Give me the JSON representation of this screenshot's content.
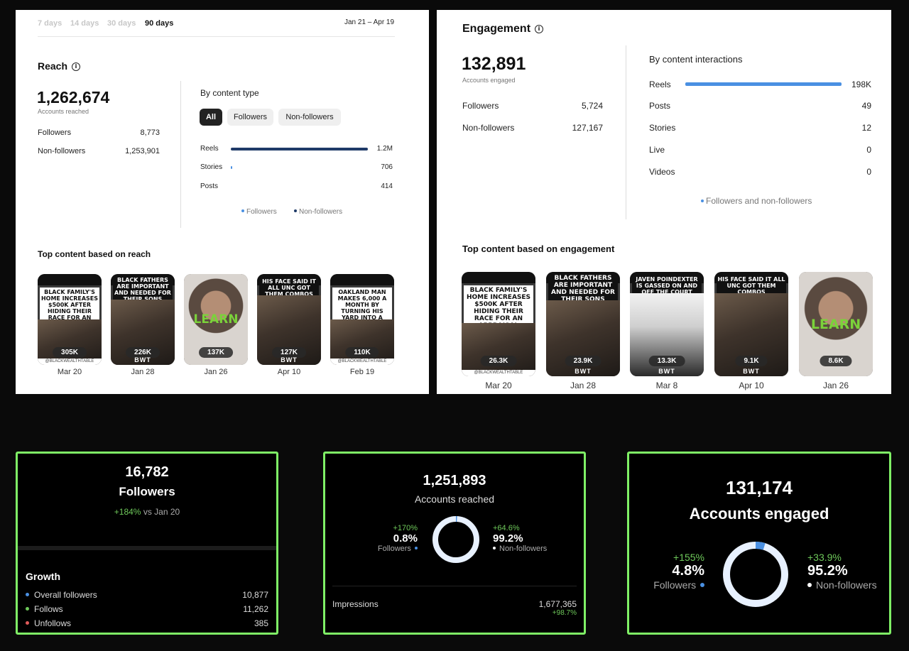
{
  "reach": {
    "ranges": [
      "7 days",
      "14 days",
      "30 days",
      "90 days"
    ],
    "active_range": "90 days",
    "date_range": "Jan 21 – Apr 19",
    "title": "Reach",
    "total": "1,262,674",
    "total_label": "Accounts reached",
    "followers_label": "Followers",
    "followers_value": "8,773",
    "nonfollowers_label": "Non-followers",
    "nonfollowers_value": "1,253,901",
    "by_type_title": "By content type",
    "pills": [
      "All",
      "Followers",
      "Non-followers"
    ],
    "bars": [
      {
        "label": "Reels",
        "value": "1.2M",
        "fraction": 1.0
      },
      {
        "label": "Stories",
        "value": "706",
        "fraction": 0.006
      },
      {
        "label": "Posts",
        "value": "414",
        "fraction": 0.0
      }
    ],
    "legend_followers": "Followers",
    "legend_nonfollowers": "Non-followers",
    "top_title": "Top content based on reach",
    "items": [
      {
        "headline": "Black family's home increases $500K after hiding their race for an appraisal",
        "count": "305K",
        "date": "Mar 20",
        "ribbon": "@BLACKWEALTHTABLE"
      },
      {
        "headline": "Black fathers are important and needed for their sons",
        "count": "226K",
        "date": "Jan 28",
        "logo": "BWT"
      },
      {
        "overlay": "LEARN",
        "count": "137K",
        "date": "Jan 26"
      },
      {
        "headline": "His face said it all unc got them combos",
        "count": "127K",
        "date": "Apr 10",
        "logo": "BWT"
      },
      {
        "headline": "Oakland man makes 6,000 a month by turning his yard into a hotel",
        "count": "110K",
        "date": "Feb 19",
        "ribbon": "@BLACKWEALTHTABLE"
      }
    ]
  },
  "engagement": {
    "title": "Engagement",
    "total": "132,891",
    "total_label": "Accounts engaged",
    "followers_label": "Followers",
    "followers_value": "5,724",
    "nonfollowers_label": "Non-followers",
    "nonfollowers_value": "127,167",
    "by_title": "By content interactions",
    "bars": [
      {
        "label": "Reels",
        "value": "198K",
        "fraction": 1.0
      },
      {
        "label": "Posts",
        "value": "49",
        "fraction": 0.0
      },
      {
        "label": "Stories",
        "value": "12",
        "fraction": 0.0
      },
      {
        "label": "Live",
        "value": "0",
        "fraction": 0.0
      },
      {
        "label": "Videos",
        "value": "0",
        "fraction": 0.0
      }
    ],
    "legend": "Followers and non-followers",
    "top_title": "Top content based on engagement",
    "items": [
      {
        "headline": "Black family's home increases $500K after hiding their race for an appraisal",
        "count": "26.3K",
        "date": "Mar 20",
        "ribbon": "@BLACKWEALTHTABLE"
      },
      {
        "headline": "Black fathers are important and needed for their sons",
        "count": "23.9K",
        "date": "Jan 28",
        "logo": "BWT"
      },
      {
        "headline": "Javen Poindexter is gassed on and off the court",
        "count": "13.3K",
        "date": "Mar 8",
        "logo": "BWT"
      },
      {
        "headline": "His face said it all unc got them combos",
        "count": "9.1K",
        "date": "Apr 10",
        "logo": "BWT"
      },
      {
        "overlay": "LEARN",
        "count": "8.6K",
        "date": "Jan 26"
      }
    ]
  },
  "followers_card": {
    "value": "16,782",
    "label": "Followers",
    "change": "+184%",
    "change_suffix": "vs Jan 20",
    "growth_title": "Growth",
    "rows": [
      {
        "label": "Overall followers",
        "value": "10,877",
        "dot_color": "#4a90e2"
      },
      {
        "label": "Follows",
        "value": "11,262",
        "dot_color": "#6ec85a"
      },
      {
        "label": "Unfollows",
        "value": "385",
        "dot_color": "#e05a5a"
      }
    ]
  },
  "reached_card": {
    "value": "1,251,893",
    "label": "Accounts reached",
    "left_change": "+170%",
    "left_pct": "0.8%",
    "left_label": "Followers",
    "right_change": "+64.6%",
    "right_pct": "99.2%",
    "right_label": "Non-followers",
    "follower_share": 0.008,
    "impressions_label": "Impressions",
    "impressions_value": "1,677,365",
    "impressions_change": "+98.7%"
  },
  "engaged_card": {
    "value": "131,174",
    "label": "Accounts engaged",
    "left_change": "+155%",
    "left_pct": "4.8%",
    "left_label": "Followers",
    "right_change": "+33.9%",
    "right_pct": "95.2%",
    "right_label": "Non-followers",
    "follower_share": 0.048
  },
  "colors": {
    "reach_bar": "#1f3a68",
    "engagement_bar": "#4a90e2",
    "followers_dot": "#4a90e2",
    "card_border": "#7ff066",
    "donut_light": "#e8f1ff",
    "donut_blue": "#4a90e2"
  }
}
